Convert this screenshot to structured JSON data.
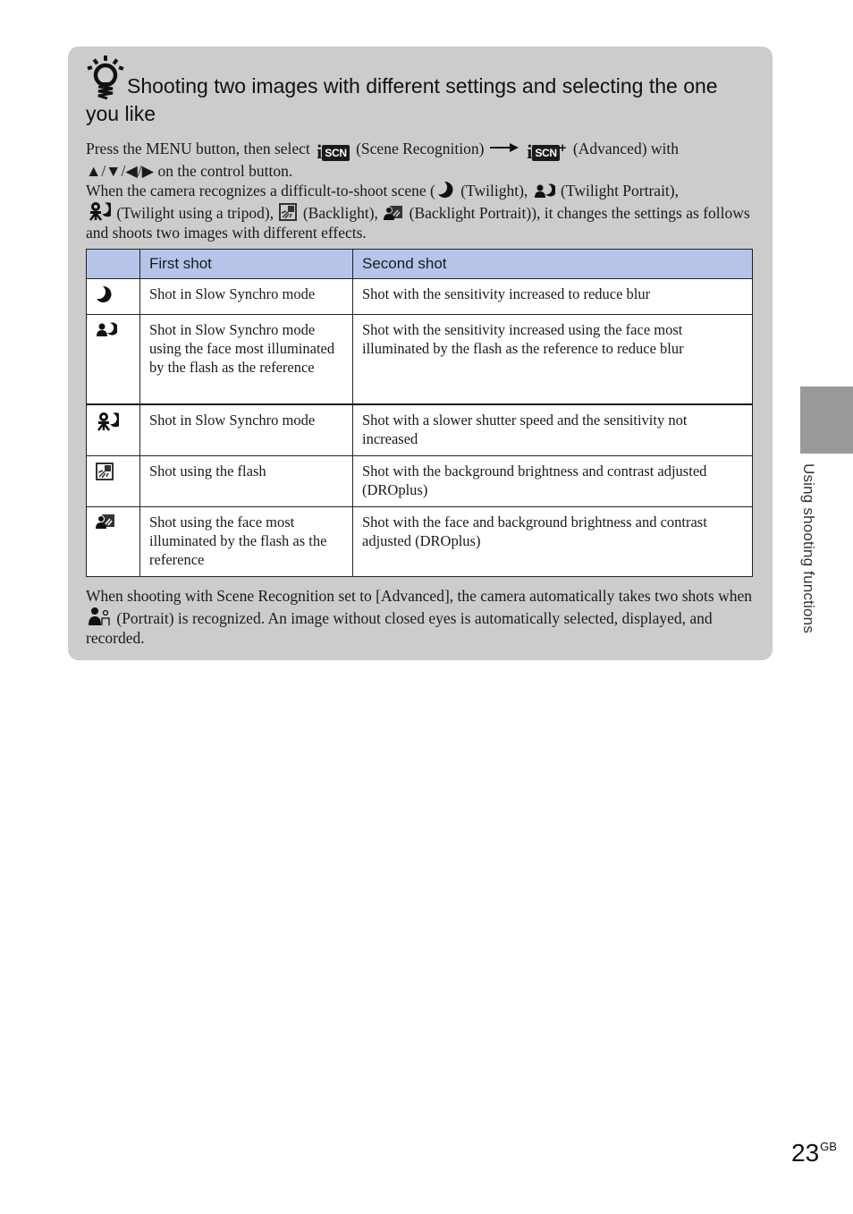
{
  "tip": {
    "icon": "lightbulb-hint-icon",
    "title": "Shooting two images with different settings and selecting the one you like",
    "para1": {
      "part1": "Press the MENU button, then select",
      "icon1": "iscn-scene-recognition-icon",
      "part2": "(Scene Recognition)",
      "arrow": "right-arrow-icon",
      "icon2": "iscn-plus-advanced-icon",
      "part3": "(Advanced) with",
      "part4": "▲/▼/◀/▶ on the control button.",
      "scn_label": "SCN",
      "i_label": "i",
      "plus_label": "+"
    },
    "para2": {
      "part1": "When the camera recognizes a difficult-to-shoot scene (",
      "twilight": "(Twilight),",
      "twilight_portrait": "(Twilight Portrait),",
      "twilight_tripod": "(Twilight using a tripod),",
      "backlight": "(Backlight),",
      "backlight_portrait": "(Backlight Portrait)), it changes the settings as follows and shoots two images with different effects."
    },
    "table": {
      "headers": [
        "",
        "First shot",
        "Second shot"
      ],
      "rows": [
        {
          "icon": "twilight-icon",
          "first": "Shot in Slow Synchro mode",
          "second": "Shot with the sensitivity increased to reduce blur"
        },
        {
          "icon": "twilight-portrait-icon",
          "first": "Shot in Slow Synchro mode using the face most illuminated by the flash as the reference",
          "second": "Shot with the sensitivity increased using the face most illuminated by the flash as the reference to reduce blur"
        },
        {
          "icon": "twilight-tripod-icon",
          "first": "Shot in Slow Synchro mode",
          "second": "Shot with a slower shutter speed and the sensitivity not increased"
        },
        {
          "icon": "backlight-icon",
          "first": "Shot using the flash",
          "second": "Shot with the background brightness and contrast adjusted (DROplus)"
        },
        {
          "icon": "backlight-portrait-icon",
          "first": "Shot using the face most illuminated by the flash as the reference",
          "second": "Shot with the face and background brightness and contrast adjusted (DROplus)"
        }
      ]
    },
    "para3": {
      "part1": "When shooting with Scene Recognition set to [Advanced], the camera automatically takes two shots when",
      "icon": "portrait-icon",
      "part2": "(Portrait) is recognized. An image without closed eyes is automatically selected, displayed, and recorded."
    }
  },
  "side": {
    "section_label": "Using shooting functions"
  },
  "footer": {
    "page_number": "23",
    "page_suffix": "GB"
  },
  "colors": {
    "box_bg": "#cccccc",
    "header_bg": "#b5c4e8",
    "side_tab": "#999999"
  }
}
